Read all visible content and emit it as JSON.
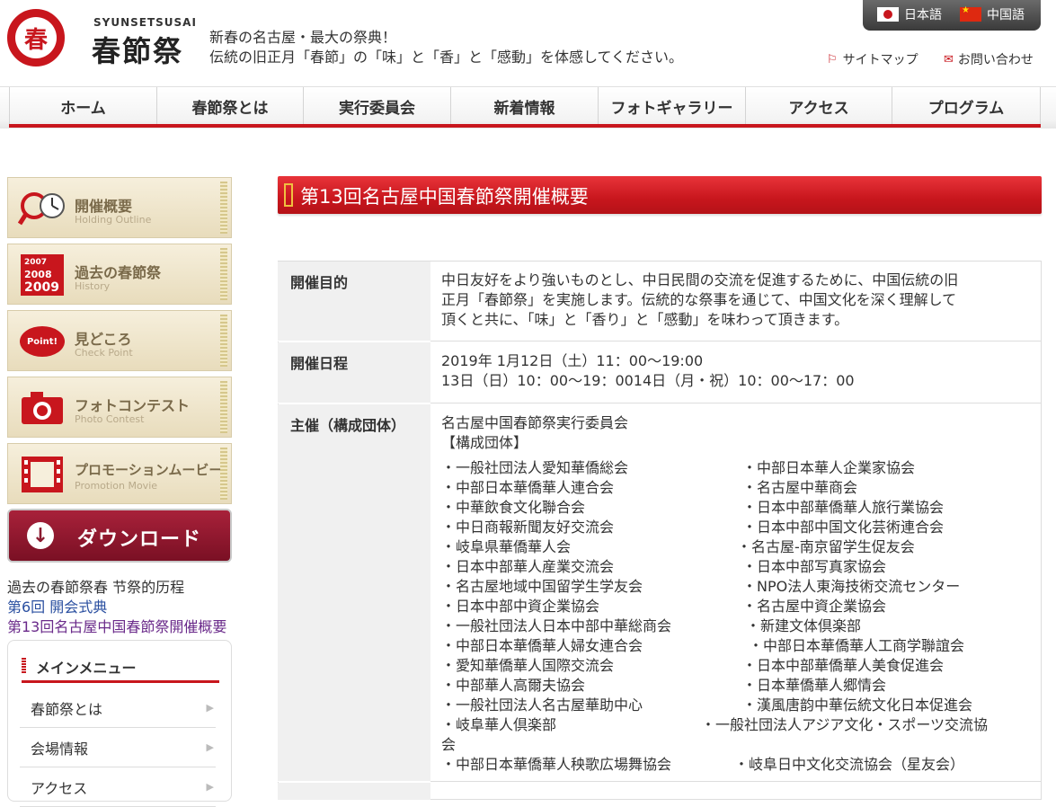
{
  "header": {
    "logo_char": "春",
    "logo_sub": "SYUNSETSUSAI",
    "logo_main": "春節祭",
    "tagline1": "新春の名古屋・最大の祭典！",
    "tagline2": "伝統の旧正月「春節」の「味」と「香」と「感動」を体感してください。",
    "lang_ja": "日本語",
    "lang_zh": "中国語",
    "sitemap": "サイトマップ",
    "contact": "お問い合わせ"
  },
  "nav": [
    "ホーム",
    "春節祭とは",
    "実行委員会",
    "新着情報",
    "フォトギャラリー",
    "アクセス",
    "プログラム"
  ],
  "sidebar": {
    "banners": [
      {
        "title": "開催概要",
        "sub": "Holding Outline",
        "icon": "magnifier-clock-icon"
      },
      {
        "title": "過去の春節祭",
        "sub": "History",
        "icon": "calendar-years-icon"
      },
      {
        "title": "見どころ",
        "sub": "Check Point",
        "icon": "speech-bubble-icon"
      },
      {
        "title": "フォトコンテスト",
        "sub": "Photo Contest",
        "icon": "camera-icon"
      },
      {
        "title": "プロモーションムービー",
        "sub": "Promotion Movie",
        "icon": "film-icon"
      }
    ],
    "history_years": [
      "2007",
      "2008",
      "2009"
    ],
    "point_badge": "Point!",
    "download": "ダウンロード",
    "history_text": "過去の春節祭春 节祭的历程",
    "link1": "第6回 開会式典",
    "link2": "第13回名古屋中国春節祭開催概要",
    "menu_title": "メインメニュー",
    "menu_items": [
      "春節祭とは",
      "会場情報",
      "アクセス"
    ]
  },
  "main": {
    "title": "第13回名古屋中国春節祭開催概要",
    "purpose_label": "開催目的",
    "purpose_lines": [
      "中日友好をより強いものとし、中日民間の交流を促進するために、中国伝統の旧",
      "正月「春節祭」を実施します。伝統的な祭事を通じて、中国文化を深く理解して",
      "頂くと共に、「味」と「香り」と「感動」を味わって頂きます。"
    ],
    "schedule_label": "開催日程",
    "schedule_lines": [
      "2019年 1月12日（土）11：00〜19:00",
      "13日（日）10：00〜19：0014日（月・祝）10：00〜17：00"
    ],
    "host_label": "主催（構成団体）",
    "host_name": "名古屋中国春節祭実行委員会",
    "members_heading": "【構成団体】",
    "members_left": [
      "・一般社団法人愛知華僑総会",
      "・中部日本華僑華人連合会",
      "・中華飲食文化聯合会",
      "・中日商報新聞友好交流会",
      "・岐阜県華僑華人会",
      "・日本中部華人産業交流会",
      "・名古屋地域中国留学生学友会",
      "・日本中部中資企業協会",
      "・一般社団法人日本中部中華総商会",
      "・中部日本華僑華人婦女連合会",
      "・愛知華僑華人国際交流会",
      "・中部華人高爾夫協会",
      "・一般社団法人名古屋華助中心",
      "・岐阜華人倶楽部"
    ],
    "members_right": [
      "・中部日本華人企業家協会",
      "・名古屋中華商会",
      "・日本中部華僑華人旅行業協会",
      "・日本中部中国文化芸術連合会",
      "・名古屋-南京留学生促友会",
      "・日本中部写真家協会",
      "・NPO法人東海技術交流センター",
      "・名古屋中資企業協会",
      "・新建文体倶楽部",
      "・中部日本華僑華人工商学聯誼会",
      "・日本中部華僑華人美食促進会",
      "・日本華僑華人郷情会",
      "・漢風唐韵中華伝統文化日本促進会"
    ],
    "member_wide_a": "・一般社団法人アジア文化・スポーツ交流協",
    "member_wide_b": "会",
    "member_last_left": "・中部日本華僑華人秧歌広場舞協会",
    "member_last_right": "・岐阜日中文化交流協会（星友会）"
  },
  "colors": {
    "brand_red": "#c8161d",
    "banner_bg": "#efe5c8",
    "download": "#8b1a30"
  }
}
